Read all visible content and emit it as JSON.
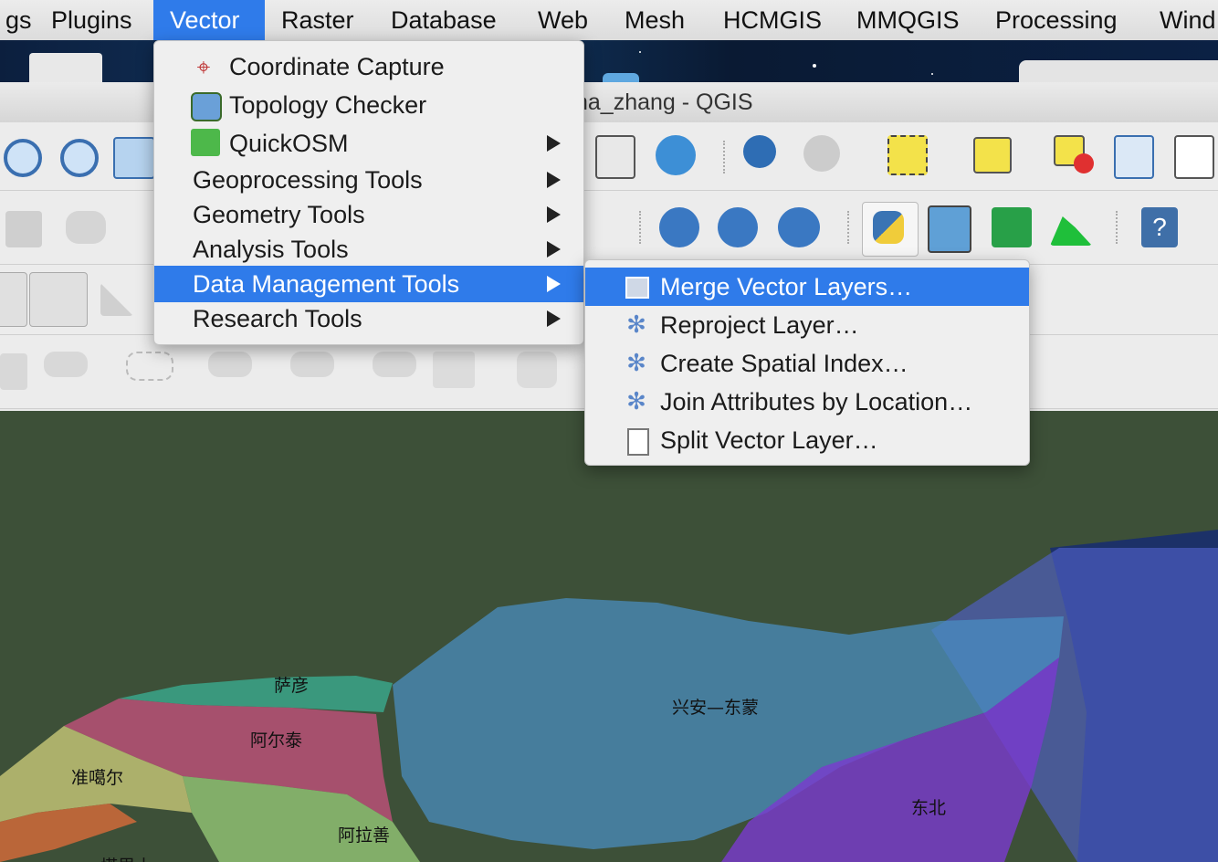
{
  "menubar": {
    "items": [
      "gs",
      "Plugins",
      "Vector",
      "Raster",
      "Database",
      "Web",
      "Mesh",
      "HCMGIS",
      "MMQGIS",
      "Processing",
      "Wind"
    ],
    "active": "Vector"
  },
  "window": {
    "title": "na_zhang - QGIS"
  },
  "vector_menu": {
    "items": [
      {
        "label": "Coordinate Capture",
        "icon": "crosshair-icon",
        "submenu": false
      },
      {
        "label": "Topology Checker",
        "icon": "topology-icon",
        "submenu": false
      },
      {
        "label": "QuickOSM",
        "icon": "quickosm-icon",
        "submenu": true
      },
      {
        "label": "Geoprocessing Tools",
        "submenu": true
      },
      {
        "label": "Geometry Tools",
        "submenu": true
      },
      {
        "label": "Analysis Tools",
        "submenu": true
      },
      {
        "label": "Data Management Tools",
        "submenu": true,
        "highlighted": true
      },
      {
        "label": "Research Tools",
        "submenu": true
      }
    ]
  },
  "data_management_submenu": {
    "items": [
      {
        "label": "Merge Vector Layers…",
        "icon": "merge-layers-icon",
        "highlighted": true
      },
      {
        "label": "Reproject Layer…",
        "icon": "gear-icon"
      },
      {
        "label": "Create Spatial Index…",
        "icon": "gear-icon"
      },
      {
        "label": "Join Attributes by Location…",
        "icon": "gear-icon"
      },
      {
        "label": "Split Vector Layer…",
        "icon": "split-layer-icon"
      }
    ]
  },
  "map": {
    "labels": [
      "萨彦",
      "阿尔泰",
      "准噶尔",
      "阿拉善",
      "兴安—东蒙",
      "东北",
      "塔里木"
    ],
    "colors": {
      "sayan": "#3aa58a",
      "altai": "#c0507a",
      "junggar": "#c8c878",
      "alashan": "#9acd7a",
      "xingan": "#4a8fc4",
      "dongbei": "#7a3ad0",
      "east": "#5060c8"
    }
  },
  "colors": {
    "accent": "#2f7bea",
    "menu_bg": "#efefef"
  }
}
